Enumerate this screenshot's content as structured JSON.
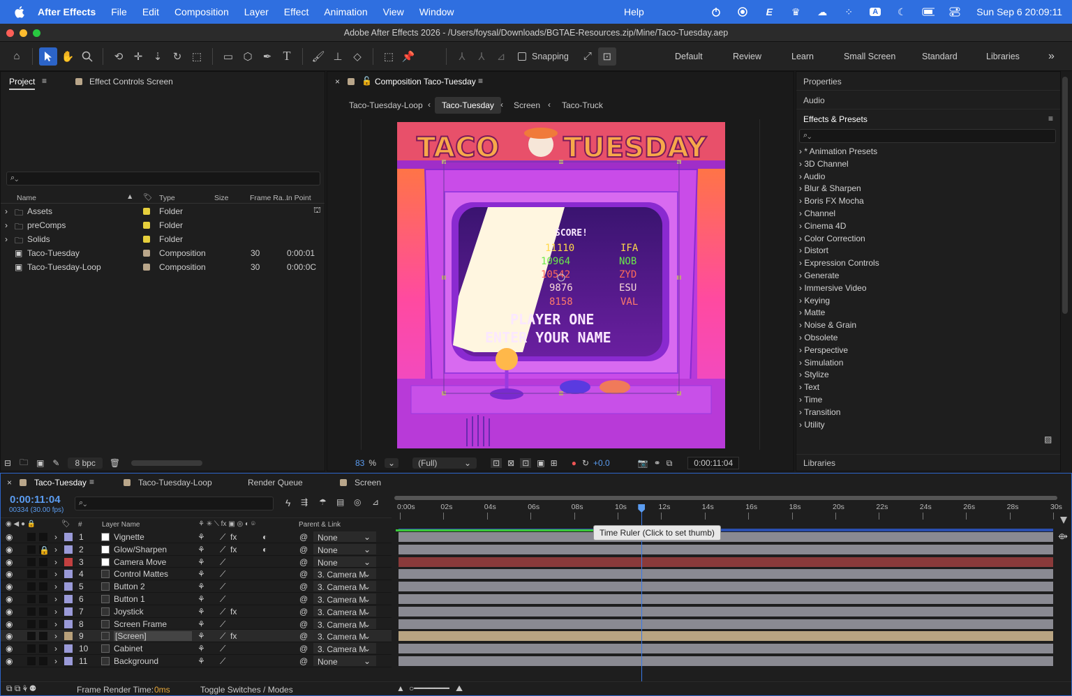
{
  "menubar": {
    "app": "After Effects",
    "items": [
      "File",
      "Edit",
      "Composition",
      "Layer",
      "Effect",
      "Animation",
      "View",
      "Window",
      "Help"
    ],
    "clock": "Sun Sep 6  20:09:11"
  },
  "window": {
    "title": "Adobe After Effects 2026 - /Users/foysal/Downloads/BGTAE-Resources.zip/Mine/Taco-Tuesday.aep"
  },
  "toolbar": {
    "snapping": "Snapping",
    "workspaces": [
      "Default",
      "Review",
      "Learn",
      "Small Screen",
      "Standard",
      "Libraries"
    ],
    "more": "»"
  },
  "project": {
    "tab": "Project",
    "tab2": "Effect Controls Screen",
    "bpc": "8 bpc",
    "columns": [
      "Name",
      "Type",
      "Size",
      "Frame Ra...",
      "In Point"
    ],
    "items": [
      {
        "name": "Assets",
        "type": "Folder",
        "fps": "",
        "in": ""
      },
      {
        "name": "preComps",
        "type": "Folder",
        "fps": "",
        "in": ""
      },
      {
        "name": "Solids",
        "type": "Folder",
        "fps": "",
        "in": ""
      },
      {
        "name": "Taco-Tuesday",
        "type": "Composition",
        "fps": "30",
        "in": "0:00:01"
      },
      {
        "name": "Taco-Tuesday-Loop",
        "type": "Composition",
        "fps": "30",
        "in": "0:00:0C"
      }
    ]
  },
  "comp": {
    "tab": "Composition Taco-Tuesday",
    "breadcrumbs": [
      "Taco-Tuesday-Loop",
      "Taco-Tuesday",
      "Screen",
      "Taco-Truck"
    ],
    "zoom": "83",
    "zoom_unit": "%",
    "quality": "(Full)",
    "exposure": "+0.0",
    "time": "0:00:11:04",
    "art": {
      "title_left": "TACO",
      "title_right": "TUESDAY",
      "score_label": "SCORE!",
      "scores": [
        [
          "11110",
          "IFA"
        ],
        [
          "10964",
          "NOB"
        ],
        [
          "10542",
          "ZYD"
        ],
        [
          "9876",
          "ESU"
        ],
        [
          "8158",
          "VAL"
        ]
      ],
      "line1": "PLAYER ONE",
      "line2": "ENTER YOUR NAME"
    }
  },
  "right": {
    "properties": "Properties",
    "audio": "Audio",
    "effects": "Effects & Presets",
    "libraries": "Libraries",
    "categories": [
      "* Animation Presets",
      "3D Channel",
      "Audio",
      "Blur & Sharpen",
      "Boris FX Mocha",
      "Channel",
      "Cinema 4D",
      "Color Correction",
      "Distort",
      "Expression Controls",
      "Generate",
      "Immersive Video",
      "Keying",
      "Matte",
      "Noise & Grain",
      "Obsolete",
      "Perspective",
      "Simulation",
      "Stylize",
      "Text",
      "Time",
      "Transition",
      "Utility"
    ]
  },
  "timeline": {
    "tabs": [
      "Taco-Tuesday",
      "Taco-Tuesday-Loop",
      "Render Queue",
      "Screen"
    ],
    "timecode": "0:00:11:04",
    "frames": "00334 (30.00 fps)",
    "col_layer": "Layer Name",
    "col_parent": "Parent & Link",
    "ruler": [
      "0:00s",
      "02s",
      "04s",
      "06s",
      "08s",
      "10s",
      "12s",
      "14s",
      "16s",
      "18s",
      "20s",
      "22s",
      "24s",
      "26s",
      "28s",
      "30s"
    ],
    "playhead_s": 11.1,
    "duration_s": 30,
    "tooltip": "Time Ruler (Click to set thumb)",
    "layers": [
      {
        "n": "1",
        "name": "Vignette",
        "parent": "None",
        "color": "#9a9ad8",
        "fx": true
      },
      {
        "n": "2",
        "name": "Glow/Sharpen",
        "parent": "None",
        "color": "#9a9ad8",
        "fx": true
      },
      {
        "n": "3",
        "name": "Camera Move",
        "parent": "None",
        "color": "#c24040",
        "fx": false
      },
      {
        "n": "4",
        "name": "Control Mattes",
        "parent": "3. Camera M",
        "color": "#9a9ad8",
        "fx": false
      },
      {
        "n": "5",
        "name": "Button 2",
        "parent": "3. Camera M",
        "color": "#9a9ad8",
        "fx": false
      },
      {
        "n": "6",
        "name": "Button 1",
        "parent": "3. Camera M",
        "color": "#9a9ad8",
        "fx": false
      },
      {
        "n": "7",
        "name": "Joystick",
        "parent": "3. Camera M",
        "color": "#9a9ad8",
        "fx": true
      },
      {
        "n": "8",
        "name": "Screen Frame",
        "parent": "3. Camera M",
        "color": "#9a9ad8",
        "fx": false
      },
      {
        "n": "9",
        "name": "[Screen]",
        "parent": "3. Camera M",
        "color": "#b8a07a",
        "fx": true
      },
      {
        "n": "10",
        "name": "Cabinet",
        "parent": "3. Camera M",
        "color": "#9a9ad8",
        "fx": false
      },
      {
        "n": "11",
        "name": "Background",
        "parent": "None",
        "color": "#9a9ad8",
        "fx": false
      }
    ],
    "footer_label": "Frame Render Time:",
    "footer_value": "0ms",
    "toggle": "Toggle Switches / Modes"
  },
  "colors": {
    "accent": "#2f6fe0",
    "timecode": "#5b9cf0"
  }
}
